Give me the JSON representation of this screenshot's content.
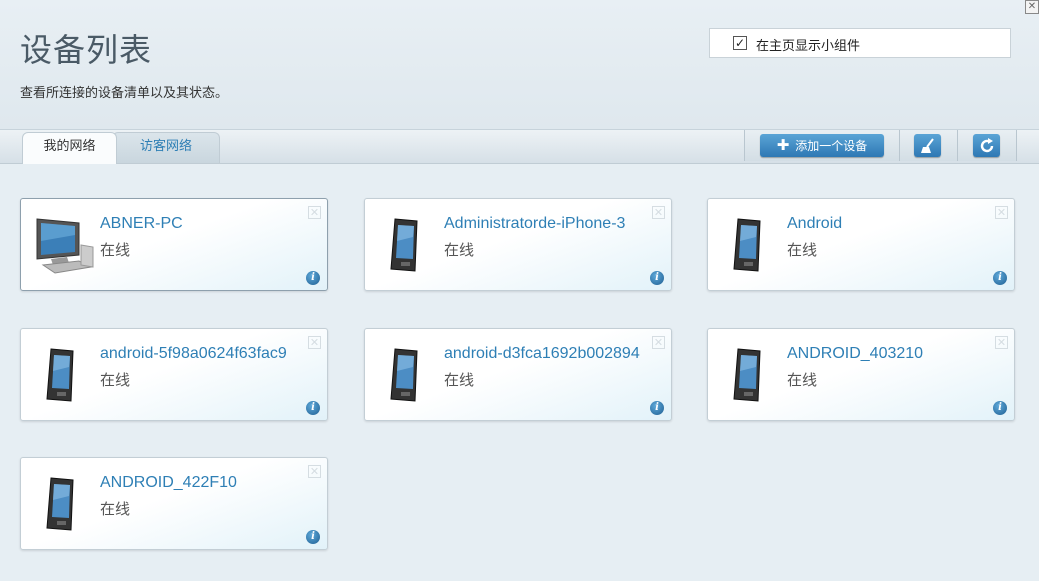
{
  "header": {
    "title": "设备列表",
    "subtitle": "查看所连接的设备清单以及其状态。",
    "widget_checkbox_label": "在主页显示小组件",
    "widget_checked": true
  },
  "tabs": {
    "mine": "我的网络",
    "guest": "访客网络"
  },
  "toolbar": {
    "add_label": "添加一个设备"
  },
  "colors": {
    "accent": "#2e7fb5",
    "button": "#3a86c2"
  },
  "devices": [
    {
      "name": "ABNER-PC",
      "status": "在线",
      "icon": "desktop-pc-icon"
    },
    {
      "name": "Administratorde-iPhone-3",
      "status": "在线",
      "icon": "phone-icon"
    },
    {
      "name": "Android",
      "status": "在线",
      "icon": "phone-icon"
    },
    {
      "name": "android-5f98a0624f63fac9",
      "status": "在线",
      "icon": "phone-icon"
    },
    {
      "name": "android-d3fca1692b002894",
      "status": "在线",
      "icon": "phone-icon"
    },
    {
      "name": "ANDROID_403210",
      "status": "在线",
      "icon": "phone-icon"
    },
    {
      "name": "ANDROID_422F10",
      "status": "在线",
      "icon": "phone-icon"
    }
  ]
}
